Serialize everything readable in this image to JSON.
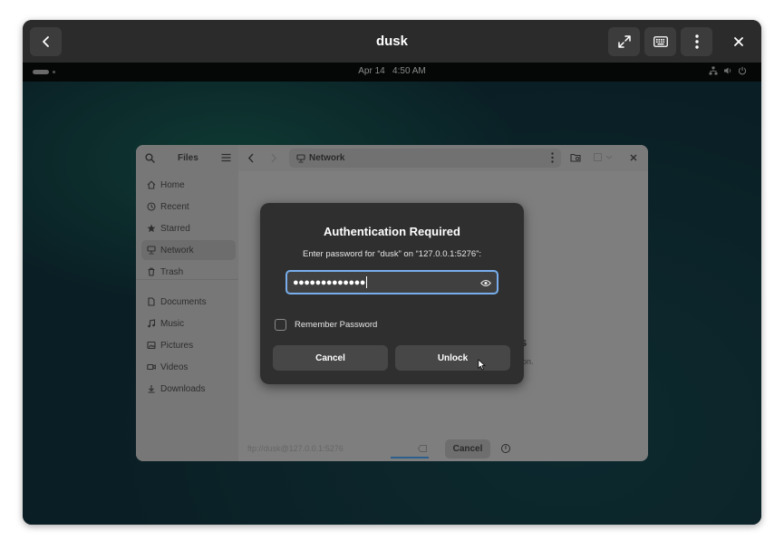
{
  "viewer": {
    "title": "dusk",
    "buttons": [
      "back-icon",
      "fullscreen-icon",
      "keyboard-icon",
      "kebab-menu-icon",
      "close-icon"
    ]
  },
  "topbar": {
    "date": "Apr 14",
    "time": "4:50 AM",
    "icons": [
      "network-icon",
      "volume-icon",
      "power-icon"
    ]
  },
  "files": {
    "title": "Files",
    "location": "Network",
    "sidebar": [
      {
        "label": "Home",
        "icon": "home-icon"
      },
      {
        "label": "Recent",
        "icon": "clock-icon"
      },
      {
        "label": "Starred",
        "icon": "star-icon"
      },
      {
        "label": "Network",
        "icon": "network-icon",
        "active": true
      },
      {
        "label": "Trash",
        "icon": "trash-icon"
      },
      {
        "label": "Documents",
        "icon": "document-icon"
      },
      {
        "label": "Music",
        "icon": "music-icon"
      },
      {
        "label": "Pictures",
        "icon": "picture-icon"
      },
      {
        "label": "Videos",
        "icon": "video-icon"
      },
      {
        "label": "Downloads",
        "icon": "download-icon"
      }
    ],
    "connect_address": "ftp://dusk@127.0.0.1:5276",
    "cancel_label": "Cancel"
  },
  "dialog": {
    "title": "Authentication Required",
    "message": "Enter password for “dusk” on “127.0.0.1:5276”:",
    "password_masked": "●●●●●●●●●●●●●",
    "remember_label": "Remember Password",
    "remember_checked": false,
    "cancel_label": "Cancel",
    "unlock_label": "Unlock"
  },
  "colors": {
    "accent": "#78aeed",
    "dialog_bg": "#2f2f2f"
  }
}
